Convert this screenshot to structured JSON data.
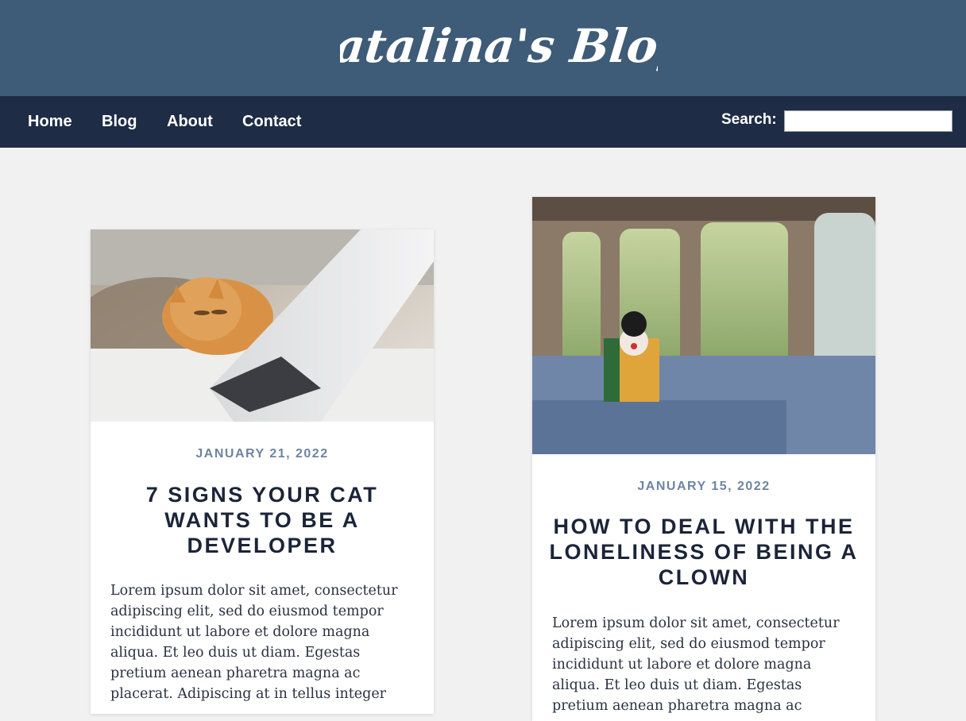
{
  "header": {
    "logo_text": "Catalina's Blog"
  },
  "nav": {
    "items": [
      {
        "label": "Home"
      },
      {
        "label": "Blog"
      },
      {
        "label": "About"
      },
      {
        "label": "Contact"
      }
    ],
    "search_label": "Search:",
    "search_value": ""
  },
  "posts": [
    {
      "date": "JANUARY 21, 2022",
      "title": "7 SIGNS YOUR CAT WANTS TO BE A DEVELOPER",
      "excerpt": "Lorem ipsum dolor sit amet, consectetur adipiscing elit, sed do eiusmod tempor incididunt ut labore et dolore magna aliqua. Et leo duis ut diam. Egestas pretium aenean pharetra magna ac placerat. Adipiscing at in tellus integer",
      "image": "cat-with-laptop-photo"
    },
    {
      "date": "JANUARY 15, 2022",
      "title": "HOW TO DEAL WITH THE LONELINESS OF BEING A CLOWN",
      "excerpt": "Lorem ipsum dolor sit amet, consectetur adipiscing elit, sed do eiusmod tempor incididunt ut labore et dolore magna aliqua. Et leo duis ut diam. Egestas pretium aenean pharetra magna ac",
      "image": "clown-on-ferry-photo"
    }
  ],
  "colors": {
    "banner": "#3e5b78",
    "nav": "#1e2c46",
    "page": "#f1f1f1",
    "date": "#6f84a0",
    "title": "#1b2438"
  }
}
